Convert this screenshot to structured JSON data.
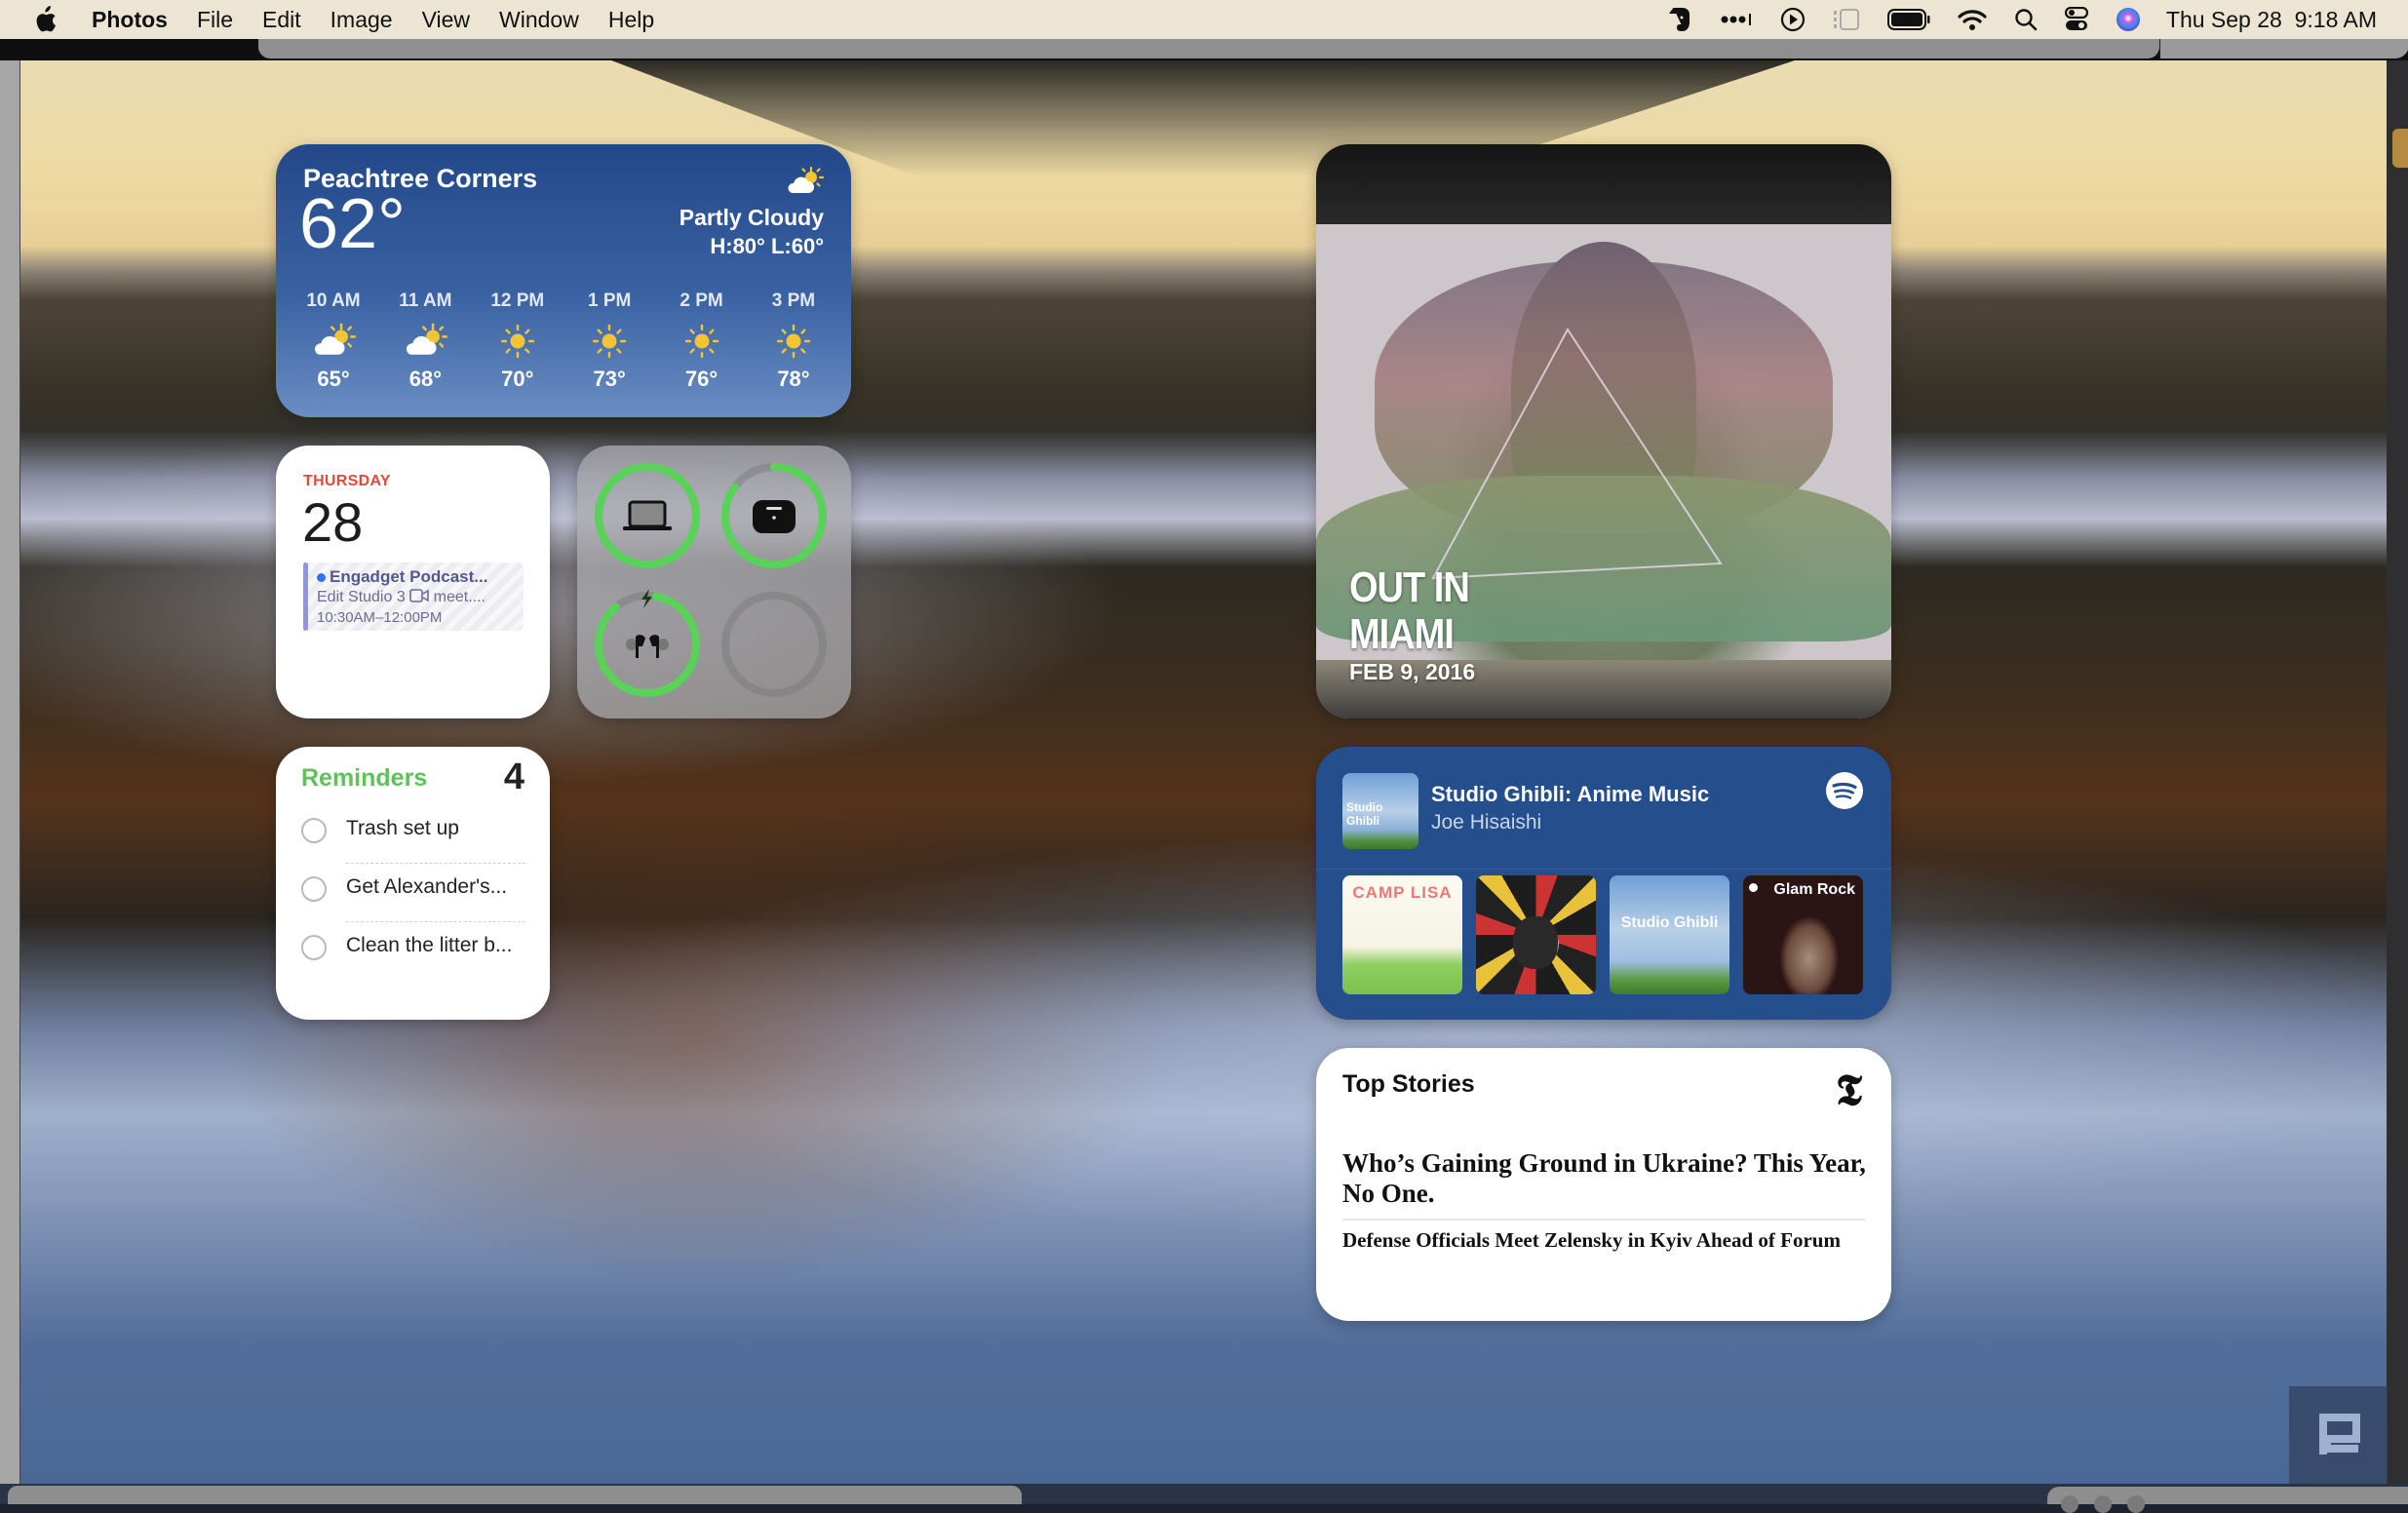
{
  "menubar": {
    "app_name": "Photos",
    "menus": [
      "File",
      "Edit",
      "Image",
      "View",
      "Window",
      "Help"
    ],
    "status_icons": [
      "evernote-icon",
      "more-dots-icon",
      "play-circle-icon",
      "stage-manager-icon",
      "battery-icon",
      "wifi-icon",
      "search-icon",
      "control-center-icon",
      "siri-icon"
    ],
    "clock": "Thu Sep 28  9:18 AM"
  },
  "weather": {
    "city": "Peachtree Corners",
    "temperature": "62°",
    "condition": "Partly Cloudy",
    "high_low": "H:80° L:60°",
    "condition_icon": "partly-cloudy-icon",
    "hourly": [
      {
        "time": "10 AM",
        "icon": "partly-cloudy",
        "temp": "65°"
      },
      {
        "time": "11 AM",
        "icon": "partly-cloudy",
        "temp": "68°"
      },
      {
        "time": "12 PM",
        "icon": "sunny",
        "temp": "70°"
      },
      {
        "time": "1 PM",
        "icon": "sunny",
        "temp": "73°"
      },
      {
        "time": "2 PM",
        "icon": "sunny",
        "temp": "76°"
      },
      {
        "time": "3 PM",
        "icon": "sunny",
        "temp": "78°"
      }
    ]
  },
  "calendar": {
    "weekday": "THURSDAY",
    "day": "28",
    "event": {
      "title": "Engadget Podcast...",
      "location": "Edit Studio 3",
      "location_suffix": "meet....",
      "time": "10:30AM–12:00PM",
      "color": "#9292e8"
    }
  },
  "batteries": {
    "devices": [
      {
        "name": "MacBook",
        "icon": "laptop-icon",
        "level": 1.0,
        "charging": false
      },
      {
        "name": "AirPods Case",
        "icon": "airpods-case-icon",
        "level": 0.85,
        "charging": false
      },
      {
        "name": "AirPods",
        "icon": "airpods-icon",
        "level": 0.92,
        "charging": true
      },
      {
        "name": "",
        "icon": "empty-slot",
        "level": 0,
        "charging": false
      }
    ],
    "ring_color": "#5ad25a"
  },
  "reminders": {
    "title": "Reminders",
    "count": "4",
    "items": [
      "Trash set up",
      "Get Alexander's...",
      "Clean the litter b..."
    ],
    "accent": "#5dc25a"
  },
  "photo": {
    "title_line1": "OUT IN",
    "title_line2": "MIAMI",
    "date": "FEB 9, 2016"
  },
  "spotify": {
    "track": "Studio Ghibli: Anime Music",
    "artist": "Joe Hisaishi",
    "cover_label": "Studio Ghibli",
    "recent": [
      {
        "label": "CAMP LISA",
        "style": "camp"
      },
      {
        "label": "",
        "style": "bill"
      },
      {
        "label": "Studio Ghibli",
        "style": "ghibli"
      },
      {
        "label": "Glam Rock",
        "style": "glam"
      }
    ]
  },
  "news": {
    "title": "Top Stories",
    "headline": "Who’s Gaining Ground in Ukraine? This Year, No One.",
    "subheadline": "Defense Officials Meet Zelensky in Kyiv Ahead of Forum"
  }
}
